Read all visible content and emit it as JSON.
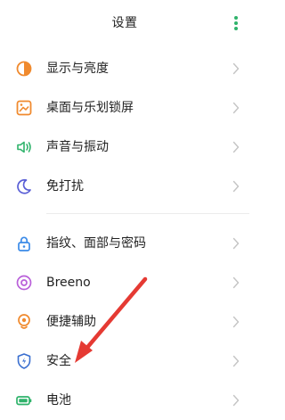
{
  "header": {
    "title": "设置"
  },
  "settings_items": [
    {
      "label": "显示与亮度",
      "icon": "display-brightness-icon",
      "color": "#f08a2e"
    },
    {
      "label": "桌面与乐划锁屏",
      "icon": "wallpaper-icon",
      "color": "#f08a2e"
    },
    {
      "label": "声音与振动",
      "icon": "sound-vibration-icon",
      "color": "#2fb36b"
    },
    {
      "label": "免打扰",
      "icon": "moon-icon",
      "color": "#5a5fd6"
    },
    {
      "label": "指纹、面部与密码",
      "icon": "lock-icon",
      "color": "#3a8ae8"
    },
    {
      "label": "Breeno",
      "icon": "breeno-icon",
      "color": "#b95fd9"
    },
    {
      "label": "便捷辅助",
      "icon": "accessibility-icon",
      "color": "#f08a2e"
    },
    {
      "label": "安全",
      "icon": "shield-icon",
      "color": "#3a6fd0"
    },
    {
      "label": "电池",
      "icon": "battery-icon",
      "color": "#2fb36b"
    }
  ],
  "colors": {
    "accent": "#2fb36b",
    "annotation_arrow": "#e53a33"
  }
}
